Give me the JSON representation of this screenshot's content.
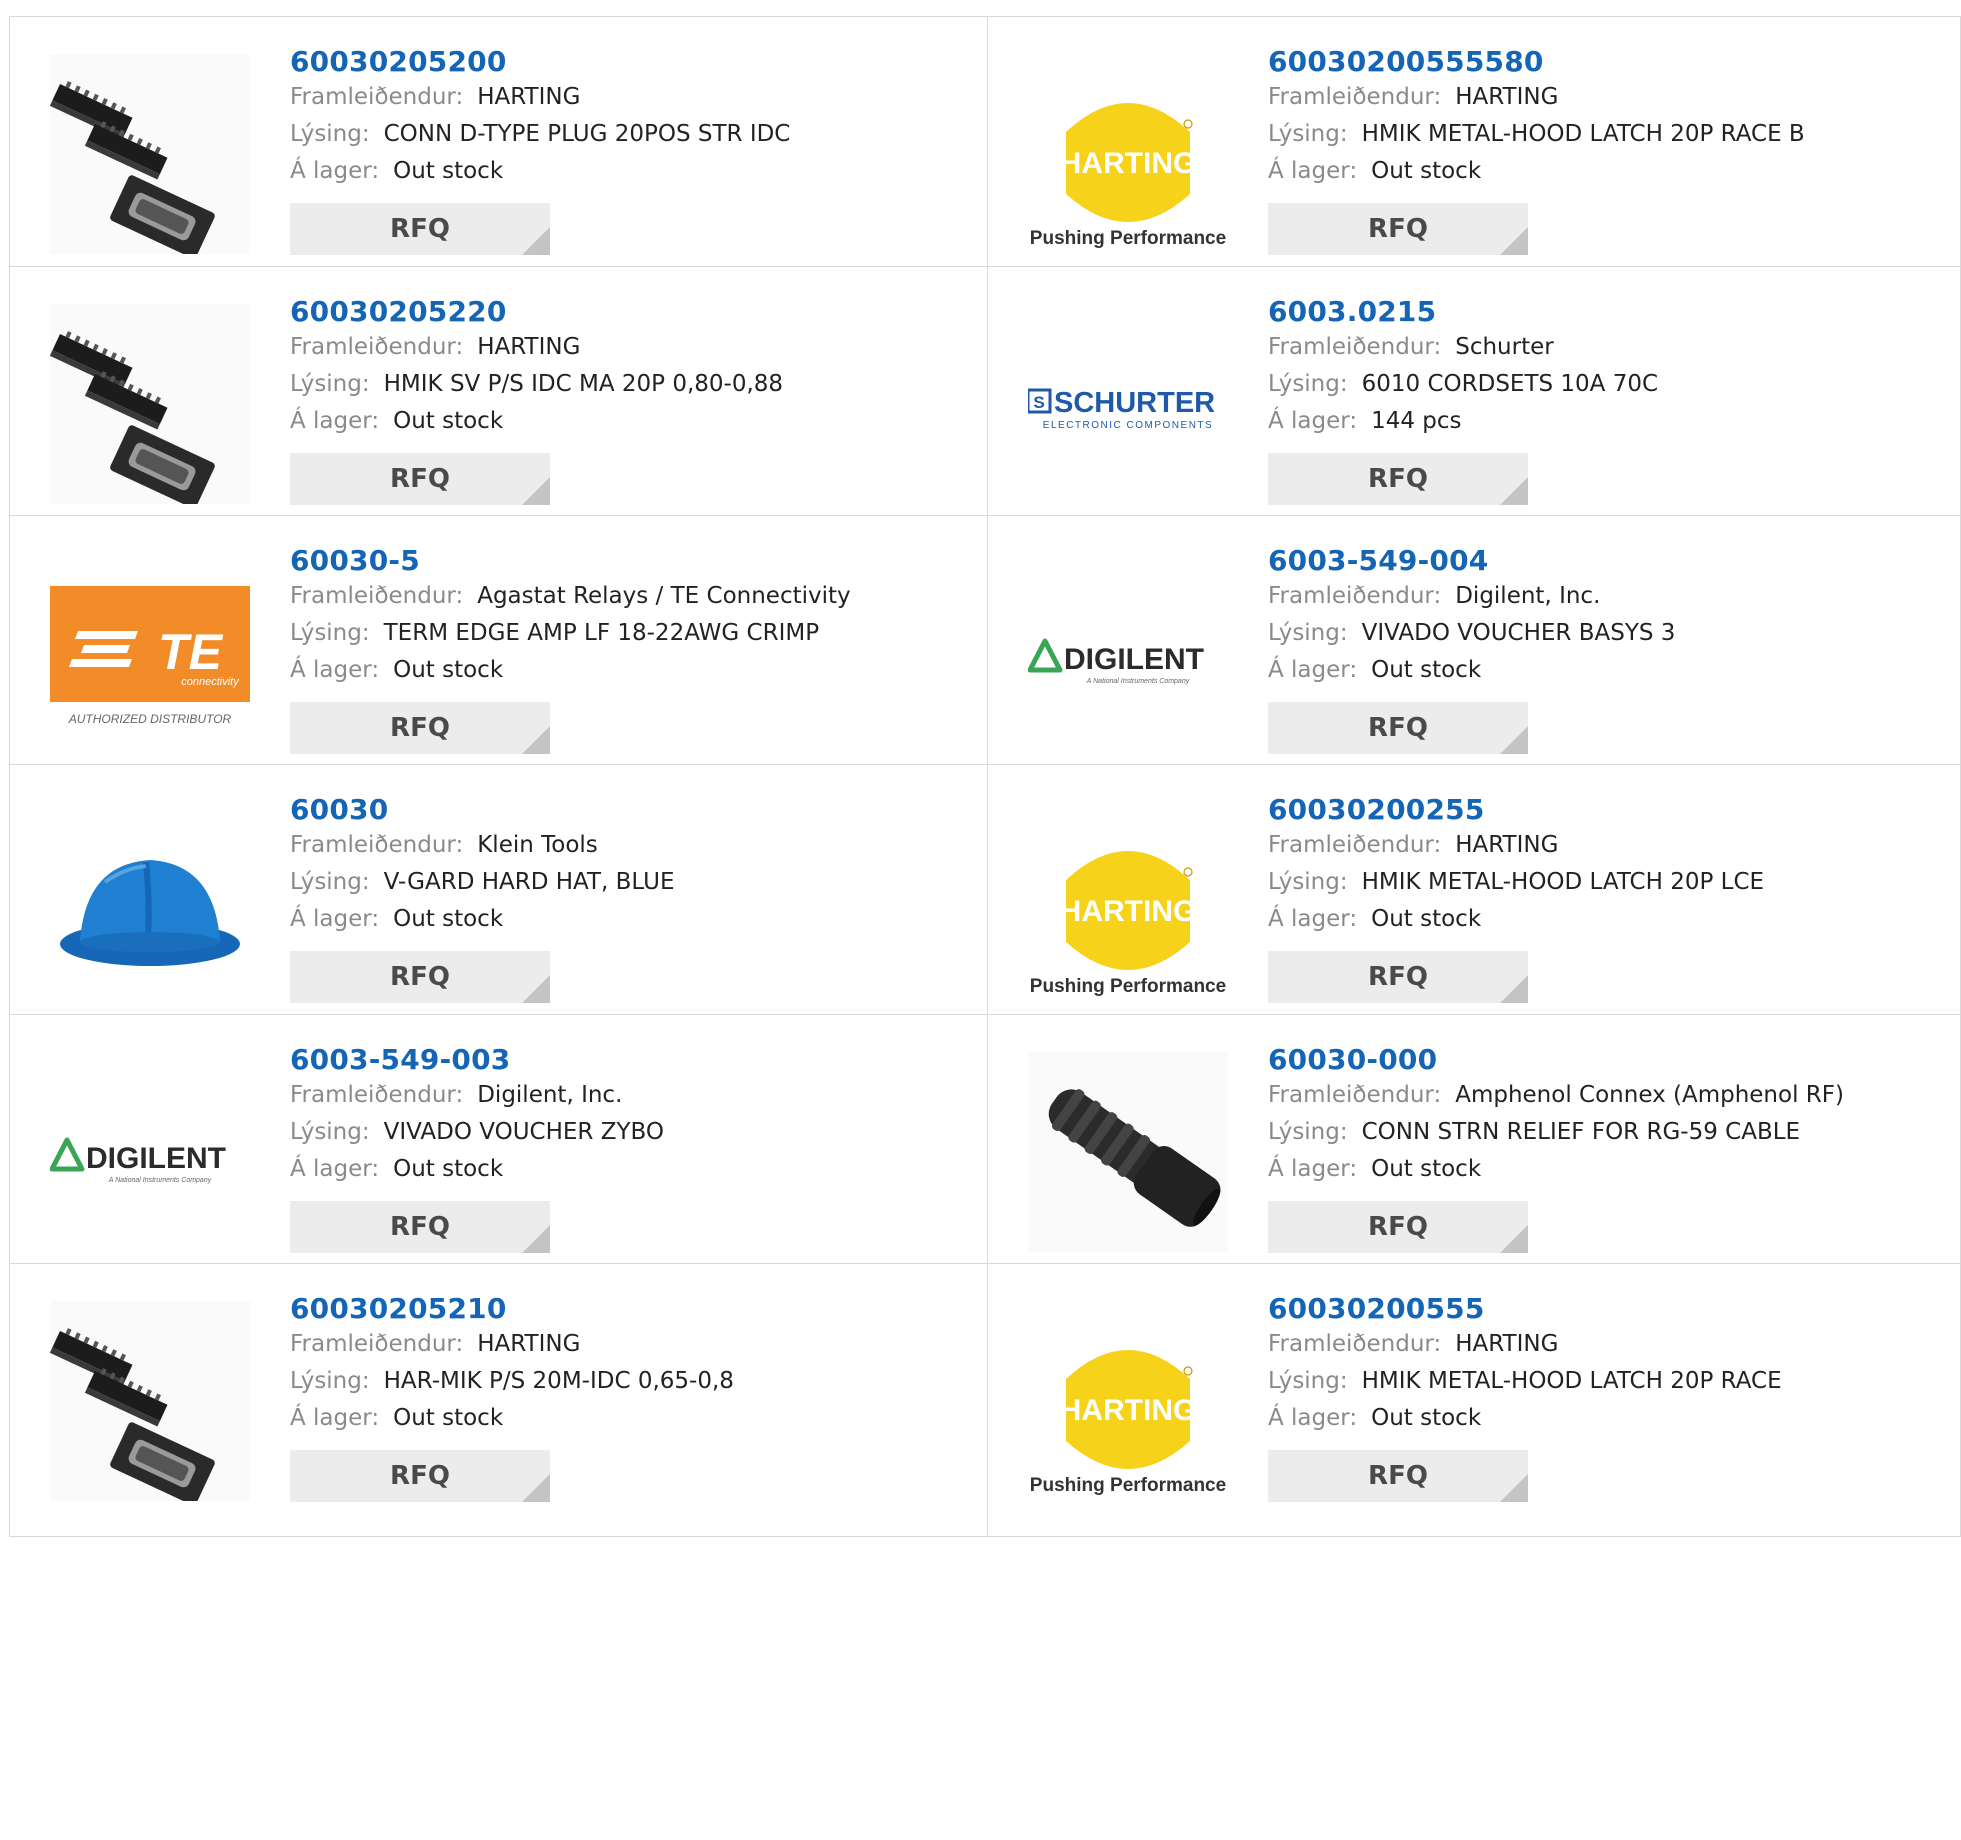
{
  "labels": {
    "manufacturer": "Framleiðendur:",
    "description": "Lýsing:",
    "stock": "Á lager:",
    "rfq": "RFQ"
  },
  "logo_text": {
    "harting": "HARTING",
    "harting_tagline": "Pushing Performance",
    "schurter": "SCHURTER",
    "schurter_sub": "ELECTRONIC COMPONENTS",
    "te": "TE",
    "te_sub": "connectivity",
    "te_badge": "AUTHORIZED DISTRIBUTOR",
    "digilent": "DIGILENT",
    "digilent_sub": "A National Instruments Company"
  },
  "colors": {
    "part_number": "#1565b6",
    "harting_yellow": "#f7d21a",
    "te_orange": "#f28c28",
    "schurter_blue": "#1e5aa8",
    "digilent_green": "#3aa655",
    "hat_blue": "#1f7fd1"
  },
  "rows": [
    {
      "left": {
        "part": "60030205200",
        "manufacturer": "HARTING",
        "description": "CONN D-TYPE PLUG 20POS STR IDC",
        "stock": "Out stock",
        "image": "connector-image"
      },
      "right": {
        "part": "60030200555580",
        "manufacturer": "HARTING",
        "description": "HMIK METAL-HOOD LATCH 20P RACE B",
        "stock": "Out stock",
        "image": "harting-logo"
      }
    },
    {
      "left": {
        "part": "60030205220",
        "manufacturer": "HARTING",
        "description": "HMIK SV P/S IDC MA 20P 0,80-0,88",
        "stock": "Out stock",
        "image": "connector-image"
      },
      "right": {
        "part": "6003.0215",
        "manufacturer": "Schurter",
        "description": "6010 CORDSETS 10A 70C",
        "stock": "144 pcs",
        "image": "schurter-logo"
      }
    },
    {
      "left": {
        "part": "60030-5",
        "manufacturer": "Agastat Relays / TE Connectivity",
        "description": "TERM EDGE AMP LF 18-22AWG CRIMP",
        "stock": "Out stock",
        "image": "te-logo"
      },
      "right": {
        "part": "6003-549-004",
        "manufacturer": "Digilent, Inc.",
        "description": "VIVADO VOUCHER BASYS 3",
        "stock": "Out stock",
        "image": "digilent-logo"
      }
    },
    {
      "left": {
        "part": "60030",
        "manufacturer": "Klein Tools",
        "description": "V-GARD HARD HAT, BLUE",
        "stock": "Out stock",
        "image": "hard-hat-image"
      },
      "right": {
        "part": "60030200255",
        "manufacturer": "HARTING",
        "description": "HMIK METAL-HOOD LATCH 20P LCE",
        "stock": "Out stock",
        "image": "harting-logo"
      }
    },
    {
      "left": {
        "part": "6003-549-003",
        "manufacturer": "Digilent, Inc.",
        "description": "VIVADO VOUCHER ZYBO",
        "stock": "Out stock",
        "image": "digilent-logo"
      },
      "right": {
        "part": "60030-000",
        "manufacturer": "Amphenol Connex (Amphenol RF)",
        "description": "CONN STRN RELIEF FOR RG-59 CABLE",
        "stock": "Out stock",
        "image": "strain-relief-image"
      }
    },
    {
      "left": {
        "part": "60030205210",
        "manufacturer": "HARTING",
        "description": "HAR-MIK P/S 20M-IDC 0,65-0,8",
        "stock": "Out stock",
        "image": "connector-image"
      },
      "right": {
        "part": "60030200555",
        "manufacturer": "HARTING",
        "description": "HMIK METAL-HOOD LATCH 20P RACE",
        "stock": "Out stock",
        "image": "harting-logo"
      }
    }
  ]
}
